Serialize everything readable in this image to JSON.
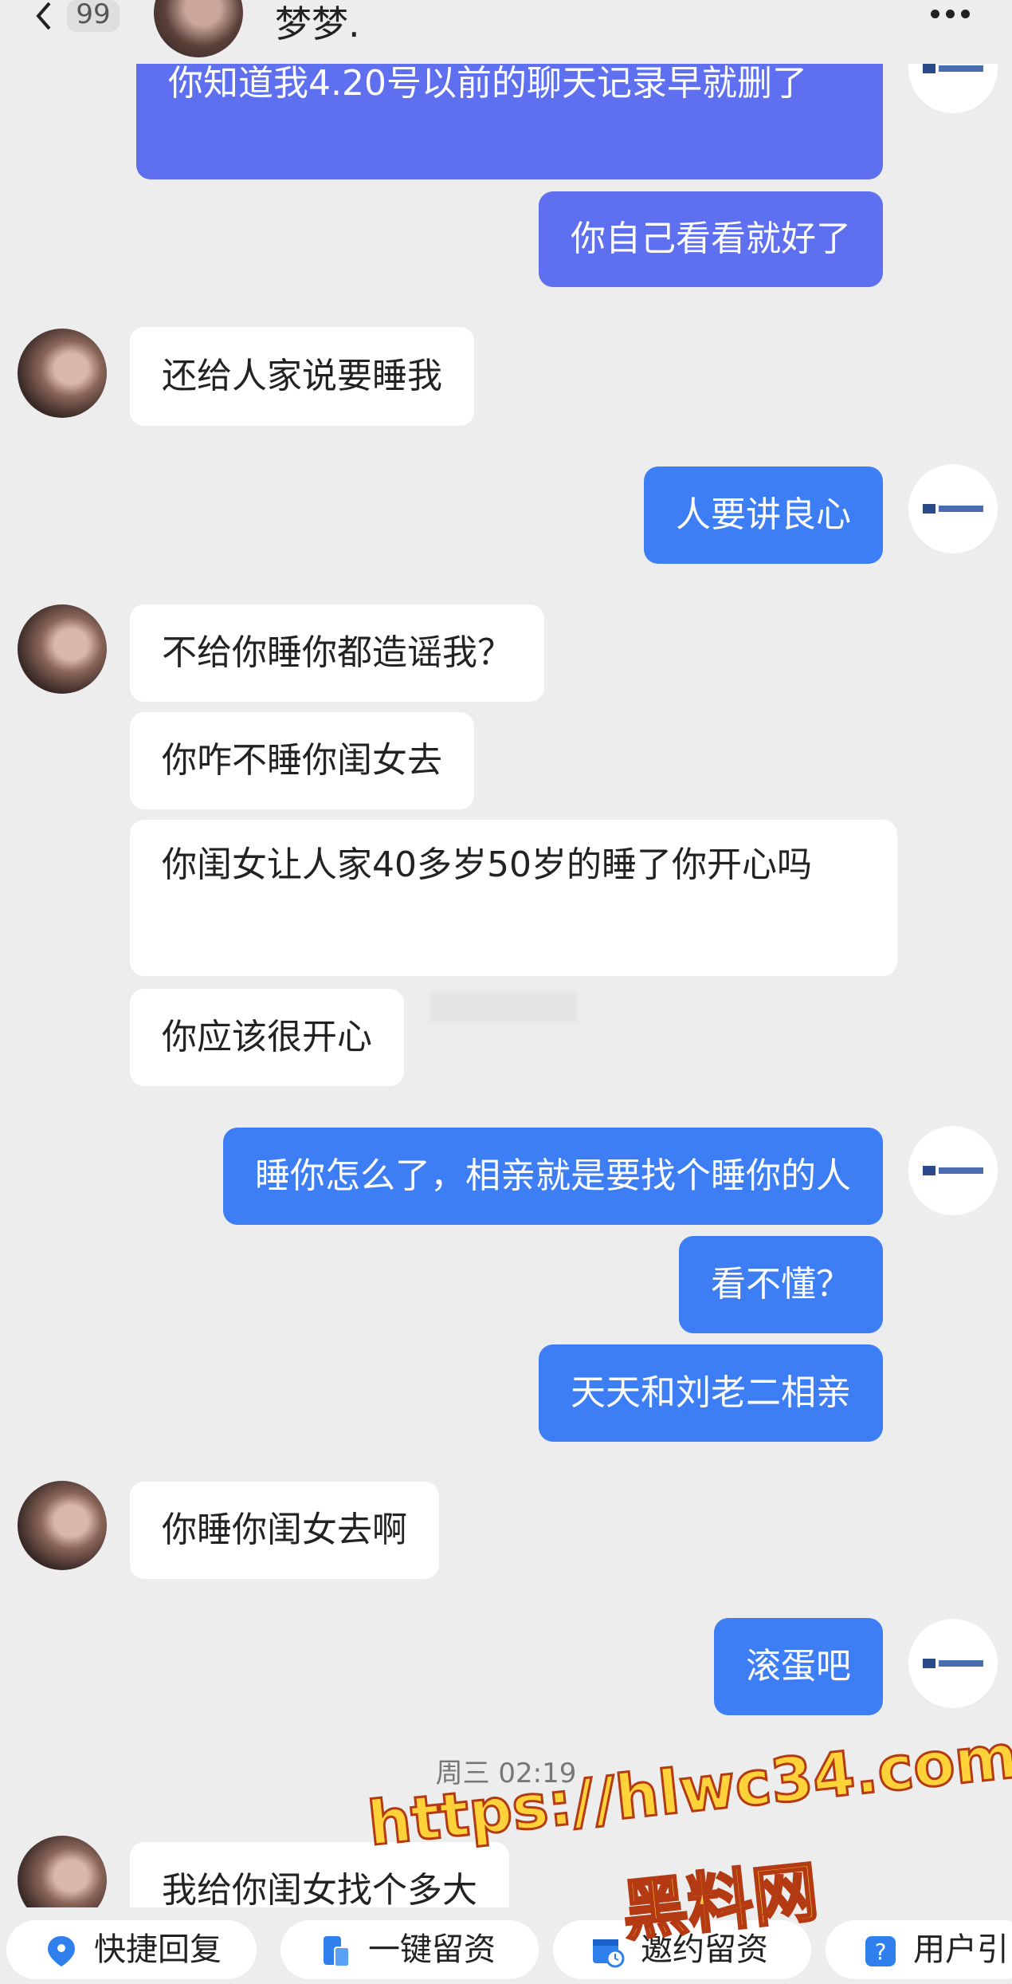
{
  "header": {
    "unread_count": "99",
    "contact_name": "梦梦."
  },
  "messages": [
    {
      "side": "right",
      "text": "你知道我4.20号以前的聊天记录早就删了"
    },
    {
      "side": "right",
      "text": "你自己看看就好了"
    },
    {
      "side": "left",
      "text": "还给人家说要睡我"
    },
    {
      "side": "right",
      "text": "人要讲良心"
    },
    {
      "side": "left",
      "text": "不给你睡你都造谣我？"
    },
    {
      "side": "left",
      "text": "你咋不睡你闺女去"
    },
    {
      "side": "left",
      "text": "你闺女让人家40多岁50岁的睡了你开心吗"
    },
    {
      "side": "left",
      "text": "你应该很开心"
    },
    {
      "side": "right",
      "text": "睡你怎么了，相亲就是要找个睡你的人"
    },
    {
      "side": "right",
      "text": "看不懂？"
    },
    {
      "side": "right",
      "text": "天天和刘老二相亲"
    },
    {
      "side": "left",
      "text": "你睡你闺女去啊"
    },
    {
      "side": "right",
      "text": "滚蛋吧"
    },
    {
      "side": "left",
      "text": "我给你闺女找个多大"
    }
  ],
  "timestamp": "周三 02:19",
  "watermark": {
    "url": "https://hlwc34.com",
    "name": "黑料网"
  },
  "quick_actions": [
    {
      "label": "快捷回复",
      "icon": "location-pin-icon"
    },
    {
      "label": "一键留资",
      "icon": "phone-form-icon"
    },
    {
      "label": "邀约留资",
      "icon": "calendar-clock-icon"
    },
    {
      "label": "用户引",
      "icon": "help-icon"
    }
  ],
  "colors": {
    "background": "#ededed",
    "bubble_right": "#3d7ef5",
    "bubble_right_top": "#5e6ff0",
    "bubble_left": "#ffffff",
    "quick_icon": "#2f80ed",
    "watermark_fill": "#ffd23a"
  }
}
